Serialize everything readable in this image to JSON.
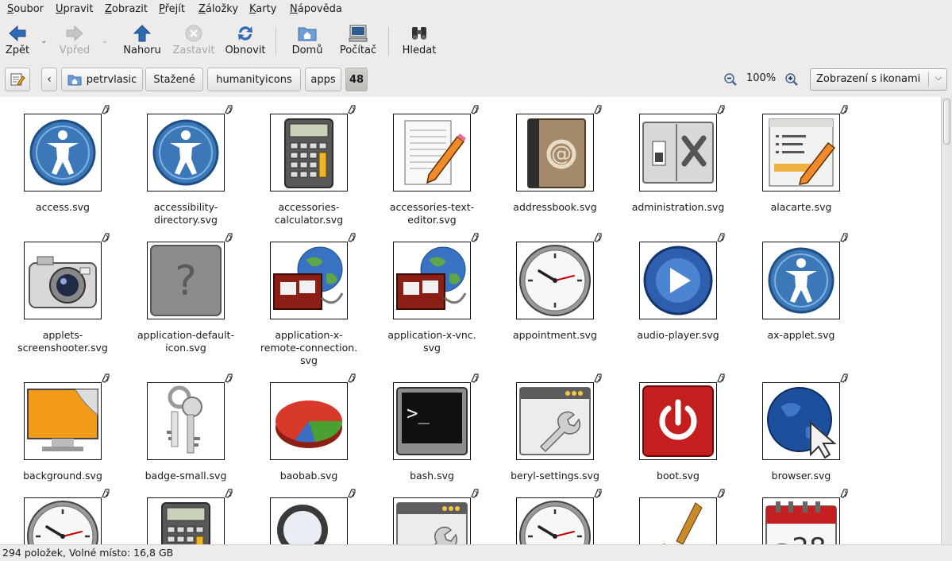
{
  "menu": [
    "Soubor",
    "Upravit",
    "Zobrazit",
    "Přejít",
    "Záložky",
    "Karty",
    "Nápověda"
  ],
  "toolbar": {
    "back": "Zpět",
    "forward": "Vpřed",
    "up": "Nahoru",
    "stop": "Zastavit",
    "reload": "Obnovit",
    "home": "Domů",
    "computer": "Počítač",
    "search": "Hledat"
  },
  "path": {
    "buttons": [
      "petrvlasic",
      "Stažené",
      "humanityicons",
      "apps",
      "48"
    ]
  },
  "zoom": {
    "level": "100%"
  },
  "view_mode": "Zobrazení s ikonami",
  "files": [
    {
      "name": "access.svg",
      "icon": "access-icon"
    },
    {
      "name": "accessibility-directory.svg",
      "icon": "accessibility-directory-icon"
    },
    {
      "name": "accessories-calculator.svg",
      "icon": "calculator-icon"
    },
    {
      "name": "accessories-text-editor.svg",
      "icon": "text-editor-icon"
    },
    {
      "name": "addressbook.svg",
      "icon": "addressbook-icon"
    },
    {
      "name": "administration.svg",
      "icon": "administration-icon"
    },
    {
      "name": "alacarte.svg",
      "icon": "alacarte-icon"
    },
    {
      "name": "applets-screenshooter.svg",
      "icon": "camera-icon"
    },
    {
      "name": "application-default-icon.svg",
      "icon": "question-icon"
    },
    {
      "name": "application-x-remote-connection.svg",
      "icon": "remote-connection-icon"
    },
    {
      "name": "application-x-vnc.svg",
      "icon": "vnc-icon"
    },
    {
      "name": "appointment.svg",
      "icon": "clock-icon"
    },
    {
      "name": "audio-player.svg",
      "icon": "play-icon"
    },
    {
      "name": "ax-applet.svg",
      "icon": "accessibility-icon"
    },
    {
      "name": "background.svg",
      "icon": "background-icon"
    },
    {
      "name": "badge-small.svg",
      "icon": "keys-icon"
    },
    {
      "name": "baobab.svg",
      "icon": "pie-chart-icon"
    },
    {
      "name": "bash.svg",
      "icon": "terminal-icon"
    },
    {
      "name": "beryl-settings.svg",
      "icon": "settings-window-icon"
    },
    {
      "name": "boot.svg",
      "icon": "power-icon"
    },
    {
      "name": "browser.svg",
      "icon": "globe-cursor-icon"
    },
    {
      "name": "",
      "icon": "clock-icon"
    },
    {
      "name": "",
      "icon": "calculator-icon"
    },
    {
      "name": "",
      "icon": "magnifier-icon"
    },
    {
      "name": "",
      "icon": "settings-window-icon"
    },
    {
      "name": "",
      "icon": "clock-icon"
    },
    {
      "name": "",
      "icon": "broom-icon"
    },
    {
      "name": "",
      "icon": "calendar-icon"
    }
  ],
  "status": "294 položek, Volné místo: 16,8 GB"
}
